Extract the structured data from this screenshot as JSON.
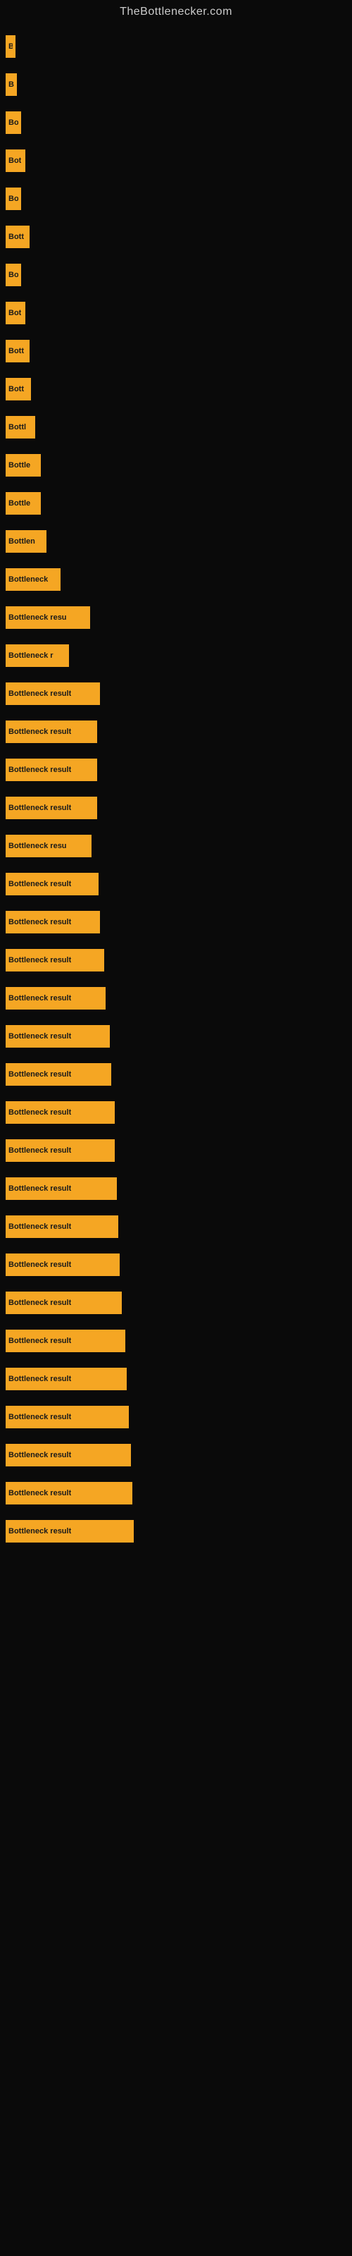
{
  "site": {
    "title": "TheBottlenecker.com"
  },
  "bars": [
    {
      "label": "B",
      "width": 14
    },
    {
      "label": "B",
      "width": 16
    },
    {
      "label": "Bo",
      "width": 22
    },
    {
      "label": "Bot",
      "width": 28
    },
    {
      "label": "Bo",
      "width": 22
    },
    {
      "label": "Bott",
      "width": 34
    },
    {
      "label": "Bo",
      "width": 22
    },
    {
      "label": "Bot",
      "width": 28
    },
    {
      "label": "Bott",
      "width": 34
    },
    {
      "label": "Bott",
      "width": 36
    },
    {
      "label": "Bottl",
      "width": 42
    },
    {
      "label": "Bottle",
      "width": 50
    },
    {
      "label": "Bottle",
      "width": 50
    },
    {
      "label": "Bottlen",
      "width": 58
    },
    {
      "label": "Bottleneck",
      "width": 78
    },
    {
      "label": "Bottleneck resu",
      "width": 120
    },
    {
      "label": "Bottleneck r",
      "width": 90
    },
    {
      "label": "Bottleneck result",
      "width": 134
    },
    {
      "label": "Bottleneck result",
      "width": 130
    },
    {
      "label": "Bottleneck result",
      "width": 130
    },
    {
      "label": "Bottleneck result",
      "width": 130
    },
    {
      "label": "Bottleneck resu",
      "width": 122
    },
    {
      "label": "Bottleneck result",
      "width": 132
    },
    {
      "label": "Bottleneck result",
      "width": 134
    },
    {
      "label": "Bottleneck result",
      "width": 140
    },
    {
      "label": "Bottleneck result",
      "width": 142
    },
    {
      "label": "Bottleneck result",
      "width": 148
    },
    {
      "label": "Bottleneck result",
      "width": 150
    },
    {
      "label": "Bottleneck result",
      "width": 155
    },
    {
      "label": "Bottleneck result",
      "width": 155
    },
    {
      "label": "Bottleneck result",
      "width": 158
    },
    {
      "label": "Bottleneck result",
      "width": 160
    },
    {
      "label": "Bottleneck result",
      "width": 162
    },
    {
      "label": "Bottleneck result",
      "width": 165
    },
    {
      "label": "Bottleneck result",
      "width": 170
    },
    {
      "label": "Bottleneck result",
      "width": 172
    },
    {
      "label": "Bottleneck result",
      "width": 175
    },
    {
      "label": "Bottleneck result",
      "width": 178
    },
    {
      "label": "Bottleneck result",
      "width": 180
    },
    {
      "label": "Bottleneck result",
      "width": 182
    }
  ]
}
